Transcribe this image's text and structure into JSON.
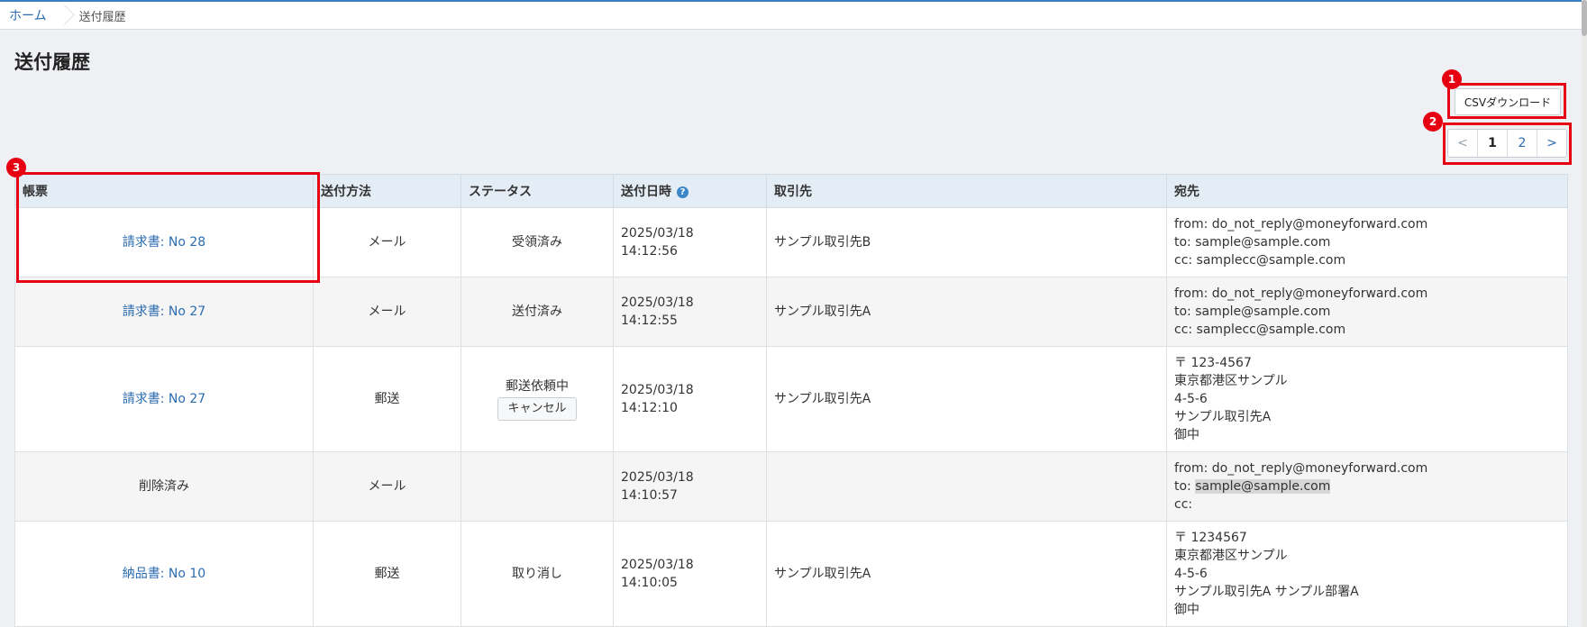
{
  "breadcrumb": {
    "home": "ホーム",
    "current": "送付履歴"
  },
  "page_title": "送付履歴",
  "csv_button": "CSVダウンロード",
  "pagination": {
    "prev": "<",
    "pages": [
      "1",
      "2"
    ],
    "next": ">",
    "current": "1"
  },
  "badges": [
    "1",
    "2",
    "3"
  ],
  "table": {
    "headers": {
      "document": "帳票",
      "method": "送付方法",
      "status": "ステータス",
      "sent_at": "送付日時",
      "client": "取引先",
      "recipient": "宛先"
    },
    "help_icon": "?",
    "rows": [
      {
        "document": "請求書: No 28",
        "method": "メール",
        "status": "受領済み",
        "date": "2025/03/18",
        "time": "14:12:56",
        "client": "サンプル取引先B",
        "recipient": [
          "from: do_not_reply@moneyforward.com",
          "to: sample@sample.com",
          "cc: samplecc@sample.com"
        ]
      },
      {
        "document": "請求書: No 27",
        "method": "メール",
        "status": "送付済み",
        "date": "2025/03/18",
        "time": "14:12:55",
        "client": "サンプル取引先A",
        "recipient": [
          "from: do_not_reply@moneyforward.com",
          "to: sample@sample.com",
          "cc: samplecc@sample.com"
        ]
      },
      {
        "document": "請求書: No 27",
        "method": "郵送",
        "status": "郵送依頼中",
        "cancel": "キャンセル",
        "date": "2025/03/18",
        "time": "14:12:10",
        "client": "サンプル取引先A",
        "recipient": [
          "〒 123-4567",
          "東京都港区サンプル",
          "4-5-6",
          "サンプル取引先A",
          "御中"
        ]
      },
      {
        "document": "削除済み",
        "method": "メール",
        "status": "",
        "date": "2025/03/18",
        "time": "14:10:57",
        "client": "",
        "recipient": [
          "from: do_not_reply@moneyforward.com",
          "to: ",
          "sample@sample.com",
          "cc:"
        ]
      },
      {
        "document": "納品書: No 10",
        "method": "郵送",
        "status": "取り消し",
        "date": "2025/03/18",
        "time": "14:10:05",
        "client": "サンプル取引先A",
        "recipient": [
          "〒 1234567",
          "東京都港区サンプル",
          "4-5-6",
          "サンプル取引先A サンプル部署A",
          "御中"
        ]
      }
    ]
  },
  "colors": {
    "accent": "#2b6cb0",
    "annotation_red": "#e60012",
    "header_bg": "#e4ecf5"
  }
}
